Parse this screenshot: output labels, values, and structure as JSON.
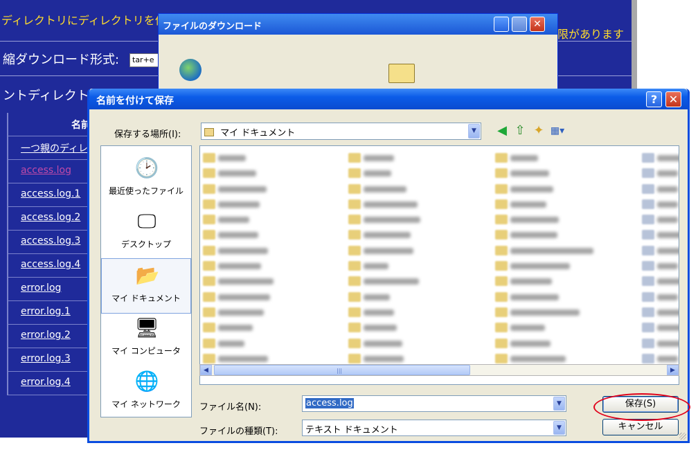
{
  "background_page": {
    "note_text": "ディレクトリにディレクトリを作成",
    "note_suffix": "限があります",
    "compress_label": "縮ダウンロード形式:",
    "compress_value": "tar+e",
    "current_dir_label": "ントディレクトリ",
    "table_header": "名前",
    "files": [
      {
        "name": "一つ親のディレ",
        "visited": false
      },
      {
        "name": "access.log",
        "visited": true
      },
      {
        "name": "access.log.1",
        "visited": false
      },
      {
        "name": "access.log.2",
        "visited": false
      },
      {
        "name": "access.log.3",
        "visited": false
      },
      {
        "name": "access.log.4",
        "visited": false
      },
      {
        "name": "error.log",
        "visited": false
      },
      {
        "name": "error.log.1",
        "visited": false
      },
      {
        "name": "error.log.2",
        "visited": false
      },
      {
        "name": "error.log.3",
        "visited": false
      },
      {
        "name": "error.log.4",
        "visited": false
      }
    ]
  },
  "download_window": {
    "title": "ファイルのダウンロード"
  },
  "save_dialog": {
    "title": "名前を付けて保存",
    "help_icon": "help-question-icon",
    "close_icon": "close-x-icon",
    "save_in_label": "保存する場所(I):",
    "save_in_value": "マイ ドキュメント",
    "toolbar_icons": [
      "back-icon",
      "up-folder-icon",
      "new-folder-icon",
      "view-menu-icon"
    ],
    "places": [
      {
        "label": "最近使ったファイル",
        "icon": "recent-files-icon",
        "selected": false
      },
      {
        "label": "デスクトップ",
        "icon": "desktop-icon",
        "selected": false
      },
      {
        "label": "マイ ドキュメント",
        "icon": "my-documents-icon",
        "selected": true
      },
      {
        "label": "マイ コンピュータ",
        "icon": "my-computer-icon",
        "selected": false
      },
      {
        "label": "マイ ネットワーク",
        "icon": "my-network-icon",
        "selected": false
      }
    ],
    "file_name_label": "ファイル名(N):",
    "file_name_value": "access.log",
    "file_type_label": "ファイルの種類(T):",
    "file_type_value": "テキスト ドキュメント",
    "save_button": "保存(S)",
    "cancel_button": "キャンセル",
    "scroll_middle_icon": "scroll-grip-icon"
  },
  "colors": {
    "page_bg": "#1f2a9a",
    "note_yellow": "#ffdc2c",
    "xp_title_blue": "#0a4bd0",
    "dialog_face": "#ece9d8",
    "highlight_oval": "#e0001a",
    "selection_blue": "#316ac5"
  }
}
